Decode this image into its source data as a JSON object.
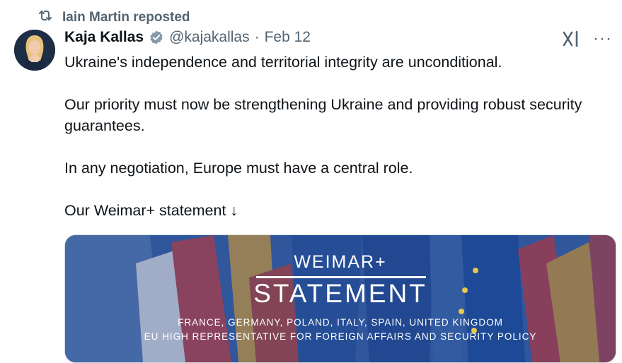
{
  "repost": {
    "icon": "repost-icon",
    "text": "Iain Martin reposted"
  },
  "tweet": {
    "author": {
      "name": "Kaja Kallas",
      "handle": "@kajakallas",
      "verified_icon": "verified-badge-icon",
      "avatar_icon": "avatar-photo"
    },
    "separator": "·",
    "date": "Feb 12",
    "actions": {
      "grok_icon": "grok-icon",
      "more_label": "···"
    },
    "paragraphs": [
      "Ukraine's independence and territorial integrity are unconditional.",
      "Our priority must now be strengthening Ukraine and providing robust security guarantees.",
      "In any negotiation, Europe must have a central role.",
      "Our Weimar+ statement ↓"
    ],
    "media": {
      "subtitle": "WEIMAR+",
      "title": "STATEMENT",
      "countries": "FRANCE, GERMANY, POLAND, ITALY, SPAIN, UNITED KINGDOM",
      "eu_rep": "EU HIGH REPRESENTATIVE FOR FOREIGN AFFAIRS AND SECURITY POLICY"
    }
  },
  "colors": {
    "muted": "#536471",
    "text": "#0f1419",
    "verified_blue": "#829aab",
    "media_blue": "#2f5ea8"
  }
}
